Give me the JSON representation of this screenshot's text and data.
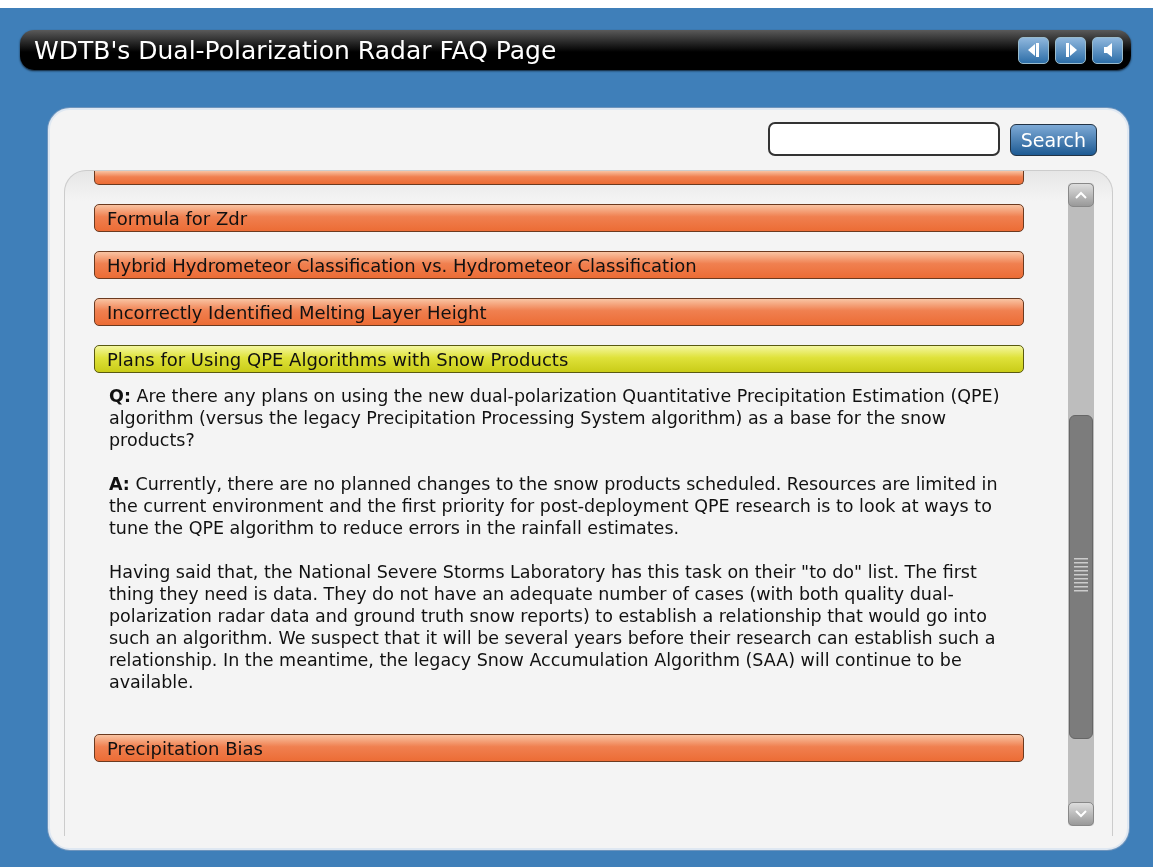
{
  "window": {
    "title": "WDTB's Dual-Polarization Radar FAQ Page"
  },
  "toolbar": {
    "buttons": [
      {
        "kind": "previous"
      },
      {
        "kind": "next"
      },
      {
        "kind": "audio"
      }
    ]
  },
  "search": {
    "button": "Search"
  },
  "faq": {
    "items": [
      {
        "kind": "clipped",
        "selected": false
      },
      {
        "kind": "topic",
        "title": "Formula for Zdr",
        "selected": false
      },
      {
        "kind": "topic",
        "title": "Hybrid Hydrometeor Classification vs. Hydrometeor Classification",
        "selected": false
      },
      {
        "kind": "topic",
        "title": "Incorrectly Identified Melting Layer Height",
        "selected": false
      },
      {
        "kind": "topic",
        "title": "Plans for Using QPE Algorithms with Snow Products",
        "selected": true,
        "answer": [
          "**Q:** Are there any plans on using the new dual-polarization Quantitative Precipitation Estimation (QPE) algorithm (versus the legacy Precipitation Processing System algorithm) as a base for the snow products?",
          "**A:** Currently, there are no planned changes to the snow products scheduled. Resources are limited in the current environment and the first priority for post-deployment QPE research is to look at ways to tune the QPE algorithm to reduce errors in the rainfall estimates.",
          "Having said that, the National Severe Storms Laboratory has this task on their \"to do\" list. The first thing they need is data. They do not have an adequate number of cases (with both quality dual-polarization radar data and ground truth snow reports) to establish a relationship that would go into such an algorithm. We suspect that it will be several years before their research can establish such a relationship. In the meantime, the legacy Snow Accumulation Algorithm (SAA) will continue to be available."
        ]
      },
      {
        "kind": "topic",
        "title": "Precipitation Bias",
        "selected": false
      }
    ]
  }
}
